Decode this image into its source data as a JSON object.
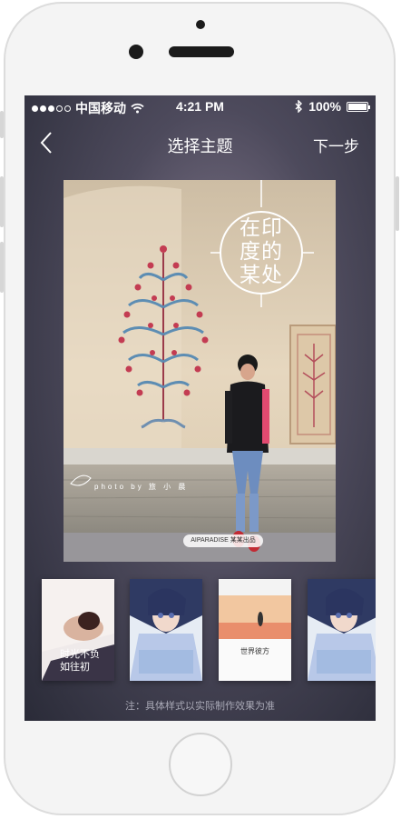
{
  "status_bar": {
    "carrier": "中国移动",
    "time": "4:21 PM",
    "battery": "100%",
    "battery_level": 1.0
  },
  "nav": {
    "title": "选择主题",
    "next_label": "下一步"
  },
  "cover": {
    "seal_text": "在印度的某处",
    "byline": "photo by 旅 小 晨",
    "publisher": "AIPARADISE 某某出品"
  },
  "themes": [
    {
      "caption": "时光不负 如往初"
    },
    {
      "caption": ""
    },
    {
      "caption": "世界彼方"
    },
    {
      "caption": ""
    }
  ],
  "note": "注：具体样式以实际制作效果为准",
  "colors": {
    "screen_dark": "#2a2b38",
    "accent_white": "#ffffff",
    "note_text": "#a9a9b6"
  }
}
